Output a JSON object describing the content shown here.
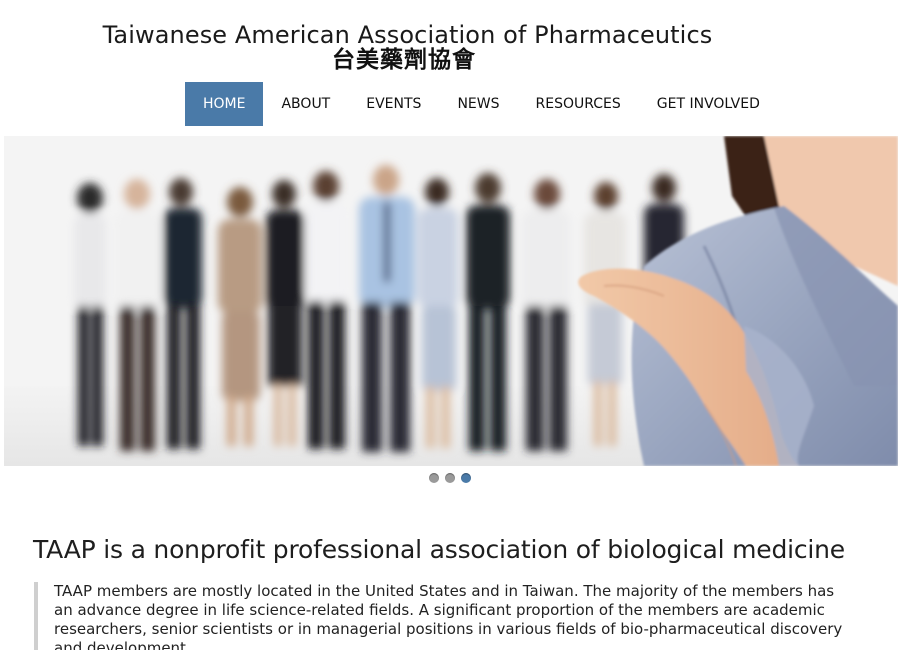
{
  "header": {
    "title": "Taiwanese American Association of Pharmaceutics",
    "title_cn": "台美藥劑協會"
  },
  "nav": {
    "items": [
      {
        "label": "HOME",
        "active": true
      },
      {
        "label": "ABOUT",
        "active": false
      },
      {
        "label": "EVENTS",
        "active": false
      },
      {
        "label": "NEWS",
        "active": false
      },
      {
        "label": "RESOURCES",
        "active": false
      },
      {
        "label": "GET INVOLVED",
        "active": false
      }
    ],
    "active_color": "#4a7aa8"
  },
  "slider": {
    "slide_count": 3,
    "active_index": 2
  },
  "main": {
    "heading": "TAAP is a nonprofit professional association of biological medicine",
    "intro": "TAAP members are mostly located in the United States and in Taiwan. The majority of the members has an advance degree in life science-related fields. A significant proportion of the members are academic researchers, senior scientists or in managerial positions in various fields of bio-pharmaceutical discovery and development."
  }
}
